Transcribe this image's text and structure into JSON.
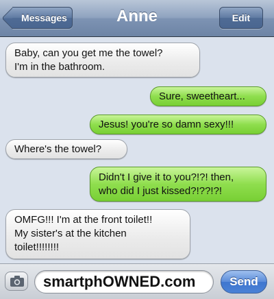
{
  "navbar": {
    "back_label": "Messages",
    "title": "Anne",
    "edit_label": "Edit"
  },
  "messages": [
    {
      "from": "received",
      "lines": [
        "Baby, can you get me the towel?",
        "I'm in the bathroom."
      ]
    },
    {
      "from": "sent",
      "lines": [
        "Sure, sweetheart..."
      ]
    },
    {
      "from": "sent",
      "lines": [
        "Jesus! you're so damn sexy!!!"
      ]
    },
    {
      "from": "received",
      "lines": [
        "Where's the towel?"
      ]
    },
    {
      "from": "sent",
      "lines": [
        "Didn't I give it to you?!?! then,",
        "who did I just kissed?!??!?!"
      ]
    },
    {
      "from": "received",
      "lines": [
        "OMFG!!! I'm at the front toilet!!",
        "My sister's at the kitchen",
        "toilet!!!!!!!!"
      ]
    }
  ],
  "input": {
    "text": "smartphOWNED.com",
    "send_label": "Send",
    "camera_icon": "camera-icon"
  },
  "colors": {
    "navbar": "#8fa3bf",
    "background": "#dbe2ed",
    "sent_bubble": "#8fde4e",
    "received_bubble": "#ececec",
    "send_button": "#4a82d6"
  }
}
